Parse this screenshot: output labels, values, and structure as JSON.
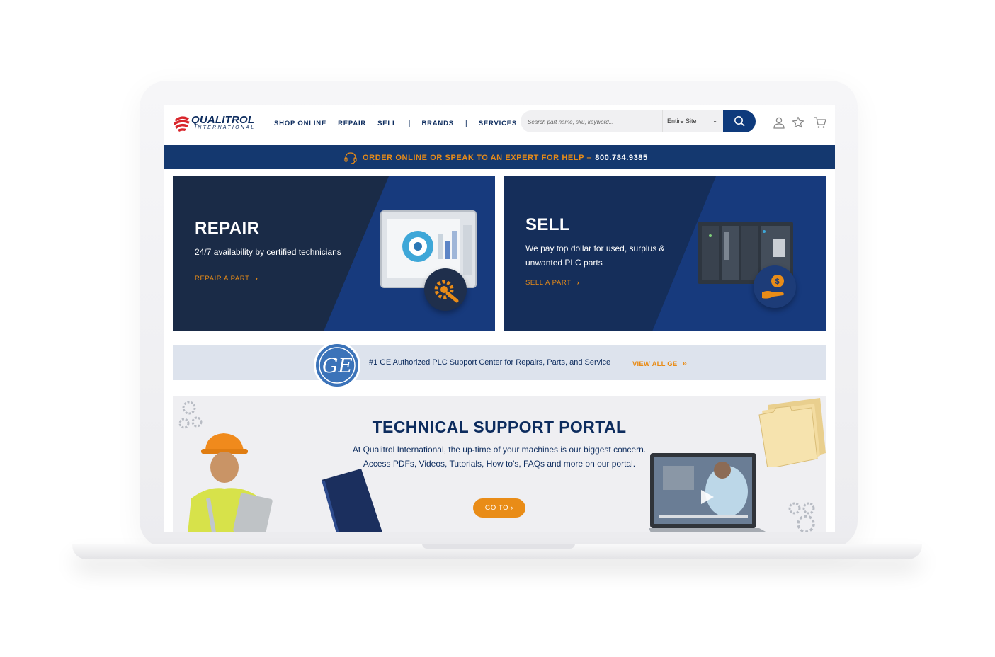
{
  "header": {
    "logo_name": "QUALITROL",
    "logo_sub": "INTERNATIONAL",
    "nav": [
      "SHOP ONLINE",
      "REPAIR",
      "SELL",
      "BRANDS",
      "SERVICES"
    ],
    "search_placeholder": "Search part name, sku, keyword...",
    "search_scope": "Entire Site"
  },
  "promo": {
    "text": "ORDER ONLINE OR SPEAK TO AN EXPERT FOR HELP –",
    "phone": "800.784.9385"
  },
  "repair_card": {
    "title": "REPAIR",
    "desc": "24/7 availability by certified technicians",
    "link": "REPAIR A PART",
    "chevron": "›"
  },
  "sell_card": {
    "title": "SELL",
    "desc_line1": "We pay top dollar for used, surplus &",
    "desc_line2": "unwanted PLC parts",
    "link": "SELL A PART",
    "chevron": "›"
  },
  "ge_strip": {
    "text": "#1 GE Authorized PLC Support Center for Repairs, Parts, and Service",
    "link": "VIEW ALL GE",
    "chevron": "»"
  },
  "portal": {
    "title": "TECHNICAL SUPPORT PORTAL",
    "desc": "At Qualitrol International, the up-time of your machines is our biggest concern. Access PDFs, Videos, Tutorials, How to's, FAQs and more on our portal.",
    "button": "GO TO ›"
  },
  "colors": {
    "navy": "#0d2c5e",
    "orange": "#e98c17",
    "banner": "#14386f"
  }
}
